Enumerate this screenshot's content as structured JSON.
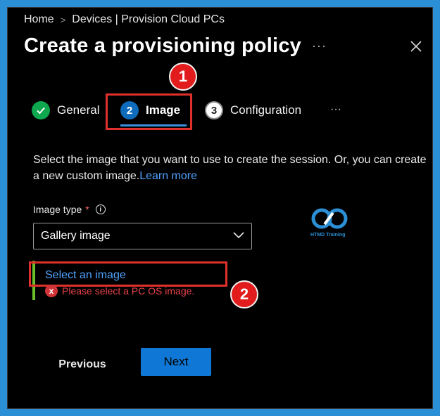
{
  "breadcrumb": {
    "home": "Home",
    "separator": ">",
    "current": "Devices | Provision Cloud PCs"
  },
  "header": {
    "title": "Create a provisioning policy",
    "more": "···",
    "close_icon": "close-icon"
  },
  "annotations": {
    "badge1": "1",
    "badge2": "2",
    "color": "#e21c1c"
  },
  "steps": [
    {
      "number": "",
      "label": "General",
      "state": "completed",
      "icon": "checkmark-icon"
    },
    {
      "number": "2",
      "label": "Image",
      "state": "active"
    },
    {
      "number": "3",
      "label": "Configuration",
      "state": "pending"
    }
  ],
  "steps_more": "···",
  "main": {
    "description": "Select the image that you want to use to create the session. Or, you can create a new custom image.",
    "learn_more": "Learn more",
    "image_type_label": "Image type",
    "required_mark": "*",
    "info_icon": "i",
    "image_type_value": "Gallery image",
    "select_image_link": "Select an image",
    "error_text": "Please select a PC OS image.",
    "error_icon": "x"
  },
  "watermark": {
    "text": "HTMD Training"
  },
  "footer": {
    "previous_label": "Previous",
    "next_label": "Next"
  },
  "colors": {
    "accent": "#0f78d6",
    "link": "#4fa3ff",
    "error": "#d13438",
    "success": "#0ea84f"
  }
}
